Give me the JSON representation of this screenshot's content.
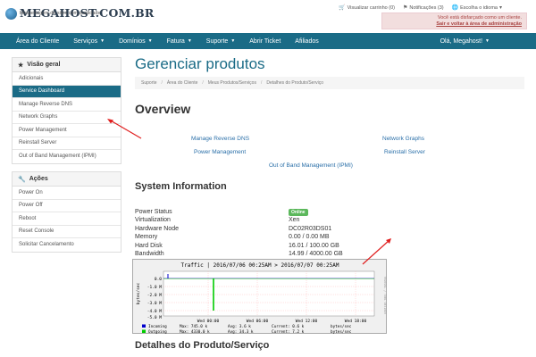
{
  "brand": {
    "name": "MEGAHOST.COM.BR",
    "tagline": "Hospedagem de sites com qualidade"
  },
  "toplinks": {
    "cart": "Visualizar carrinho (0)",
    "notifications": "Notificações (3)",
    "language": "Escolha o idioma"
  },
  "alert": {
    "line1": "Você está disfarçado como um cliente.",
    "line2": "Sair e voltar à área de administração"
  },
  "nav": {
    "items": [
      "Área do Cliente",
      "Serviços",
      "Domínios",
      "Fatura",
      "Suporte",
      "Abrir Ticket",
      "Afiliados"
    ],
    "user": "Olá, Megahost!"
  },
  "sidebar": {
    "overview": {
      "title": "Visão geral",
      "items": [
        "Adicionais",
        "Service Dashboard",
        "Manage Reverse DNS",
        "Network Graphs",
        "Power Management",
        "Reinstall Server",
        "Out of Band Management (IPMI)"
      ]
    },
    "actions": {
      "title": "Ações",
      "items": [
        "Power On",
        "Power Off",
        "Reboot",
        "Reset Console",
        "Solicitar Cancelamento"
      ]
    }
  },
  "page": {
    "title": "Gerenciar produtos",
    "breadcrumb": [
      "Suporte",
      "Área do Cliente",
      "Meus Produtos/Serviços",
      "Detalhes do Produto/Serviço"
    ],
    "overview_heading": "Overview",
    "overview_links": [
      "Manage Reverse DNS",
      "Network Graphs",
      "Power Management",
      "Reinstall Server",
      "Out of Band Management (IPMI)"
    ],
    "system_info_heading": "System Information",
    "system_info": [
      {
        "label": "Power Status",
        "value": "Online"
      },
      {
        "label": "Virtualization",
        "value": "Xen"
      },
      {
        "label": "Hardware Node",
        "value": "DC02R03DS01"
      },
      {
        "label": "Memory",
        "value": "0.00 / 0.00 MB"
      },
      {
        "label": "Hard Disk",
        "value": "16.01 / 100.00 GB"
      },
      {
        "label": "Bandwidth",
        "value": "14.99 / 4000.00 GB"
      }
    ],
    "details_heading": "Detalhes do Produto/Serviço"
  },
  "traffic_graph": {
    "title": "Traffic | 2016/07/06 00:25AM > 2016/07/07 00:25AM",
    "ylabel": "bytes/sec",
    "yticks": [
      "0.0",
      "-1.0 M",
      "-2.0 M",
      "-3.0 M",
      "-4.0 M",
      "-5.0 M"
    ],
    "xticks": [
      "Wed 00:00",
      "Wed 06:00",
      "Wed 12:00",
      "Wed 18:00"
    ],
    "legend": [
      {
        "name": "Incoming",
        "max": "Max:    745.0 k",
        "avg": "Avg:    3.6 k",
        "cur": "Current:    0.6 k",
        "unit": "bytes/sec",
        "color": "#0000cc"
      },
      {
        "name": "Outgoing",
        "max": "Max:  4330.0 k",
        "avg": "Avg:   34.3 k",
        "cur": "Current:    7.2 k",
        "unit": "bytes/sec",
        "color": "#00cc00"
      }
    ],
    "side_label": "RRDTOOL / TOBI OETIKER"
  },
  "colors": {
    "nav": "#1a6b86",
    "active": "#1a6b86",
    "title": "#1a6b86",
    "link": "#2a6fa8",
    "online": "#5cb85c",
    "annotation": "#e02020"
  }
}
